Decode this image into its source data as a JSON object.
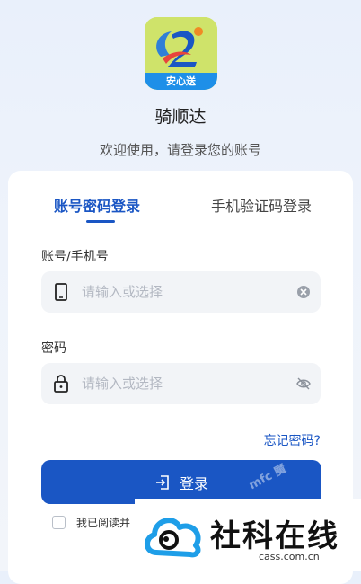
{
  "app": {
    "logo_banner": "安心送",
    "name": "骑顺达",
    "welcome": "欢迎使用，请登录您的账号"
  },
  "tabs": [
    {
      "label": "账号密码登录",
      "active": true
    },
    {
      "label": "手机验证码登录",
      "active": false
    }
  ],
  "account": {
    "label": "账号/手机号",
    "placeholder": "请输入或选择",
    "icon": "phone-icon",
    "clear_icon": "clear-icon"
  },
  "password": {
    "label": "密码",
    "placeholder": "请输入或选择",
    "icon": "lock-icon",
    "toggle_icon": "eye-off-icon"
  },
  "forgot_label": "忘记密码?",
  "login_label": "登录",
  "agreement_text": "我已阅读并",
  "watermark": {
    "small": "mfc 魔",
    "brand": "社科在线",
    "url": "cass.com.cn"
  },
  "colors": {
    "accent": "#1a56c4",
    "background": "#eef3fb",
    "field": "#f2f4f7"
  }
}
